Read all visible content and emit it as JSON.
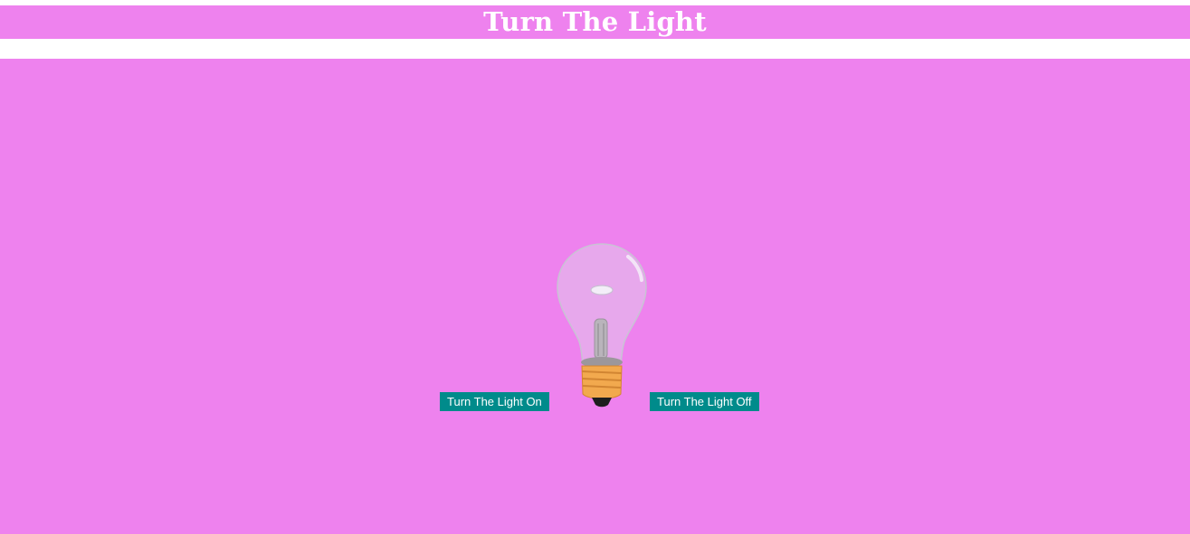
{
  "header": {
    "title": "Turn The Light"
  },
  "controls": {
    "on_label": "Turn The Light On",
    "off_label": "Turn The Light Off"
  },
  "bulb": {
    "state": "off",
    "icon": "light-bulb-icon"
  },
  "colors": {
    "background": "#ee82ee",
    "title_text": "#ffffff",
    "button_bg": "#008b8b",
    "button_text": "#ffffff"
  }
}
